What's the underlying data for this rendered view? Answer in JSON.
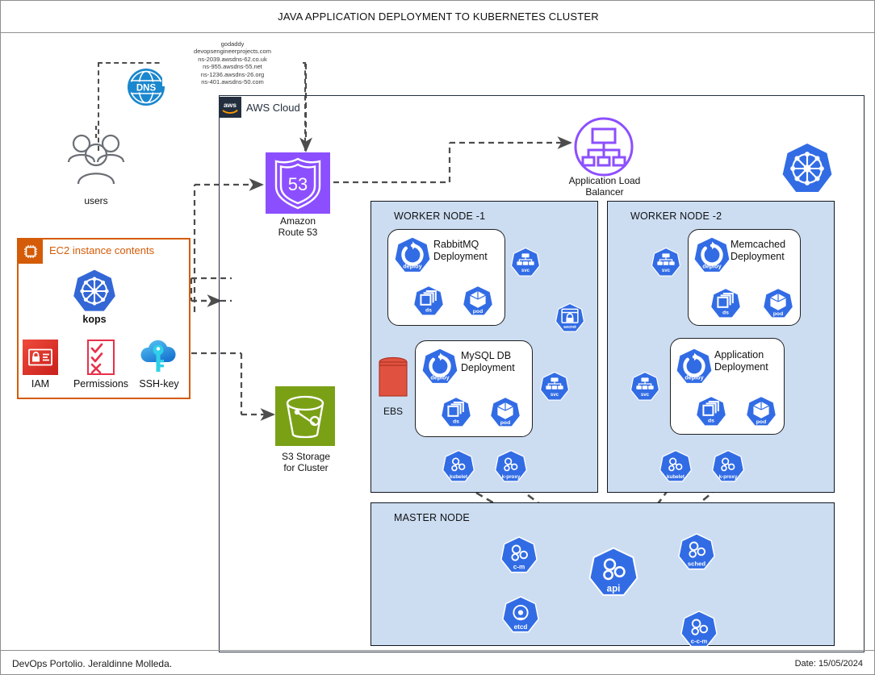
{
  "title": "JAVA APPLICATION DEPLOYMENT TO KUBERNETES CLUSTER",
  "footer": {
    "author": "DevOps Portolio. Jeraldinne Molleda.",
    "date": "Date: 15/05/2024"
  },
  "dns": {
    "icon_label": "DNS",
    "records": "godaddy\ndevopsengineerprojects.com\nns-2039.awsdns-62.co.uk\nns-955.awsdns-55.net\nns-1236.awsdns-26.org\nns-401.awsdns-50.com"
  },
  "users": {
    "label": "users"
  },
  "aws_cloud": {
    "label": "AWS Cloud",
    "tag": "aws"
  },
  "ec2": {
    "label": "EC2 instance contents",
    "items": [
      {
        "name": "kops",
        "icon": "kubernetes-kops-icon"
      },
      {
        "name": "IAM",
        "icon": "iam-icon"
      },
      {
        "name": "Permissions",
        "icon": "permissions-checklist-icon"
      },
      {
        "name": "SSH-key",
        "icon": "ssh-key-icon"
      }
    ]
  },
  "route53": {
    "label": "Amazon\nRoute 53",
    "line1": "Amazon",
    "line2": "Route 53",
    "glyph": "53",
    "color": "#8c4fff"
  },
  "s3": {
    "line1": "S3 Storage",
    "line2": "for Cluster",
    "color": "#7aa116"
  },
  "alb": {
    "line1": "Application Load",
    "line2": "Balancer",
    "color": "#8c4fff"
  },
  "k8s_logo": {
    "name": "kubernetes-logo",
    "color": "#326ce5"
  },
  "worker1": {
    "title": "WORKER NODE -1",
    "deployments": [
      {
        "title_line1": "RabbitMQ",
        "title_line2": "Deployment",
        "icons": [
          "deploy",
          "ds",
          "pod"
        ]
      },
      {
        "title_line1": "MySQL DB",
        "title_line2": "Deployment",
        "icons": [
          "deploy",
          "ds",
          "pod"
        ]
      }
    ],
    "resources": [
      {
        "label": "svc"
      },
      {
        "label": "secret"
      },
      {
        "label": "svc"
      },
      {
        "label": "kubelet"
      },
      {
        "label": "k-proxy"
      }
    ],
    "ebs": {
      "label": "EBS",
      "color": "#e0523f"
    }
  },
  "worker2": {
    "title": "WORKER NODE -2",
    "deployments": [
      {
        "title_line1": "Memcached",
        "title_line2": "Deployment",
        "icons": [
          "deploy",
          "ds",
          "pod"
        ]
      },
      {
        "title_line1": "Application",
        "title_line2": "Deployment",
        "icons": [
          "deploy",
          "ds",
          "pod"
        ]
      }
    ],
    "resources": [
      {
        "label": "svc"
      },
      {
        "label": "svc"
      },
      {
        "label": "kubelet"
      },
      {
        "label": "k-proxy"
      }
    ]
  },
  "master": {
    "title": "MASTER NODE",
    "components": [
      {
        "label": "c-m"
      },
      {
        "label": "etcd"
      },
      {
        "label": "api"
      },
      {
        "label": "sched"
      },
      {
        "label": "c-c-m"
      }
    ]
  },
  "colors": {
    "k8s_blue": "#326ce5",
    "node_panel": "#ccddf2",
    "aws_navy": "#232f3e",
    "ec2_orange": "#d45b07",
    "purple": "#8c4fff",
    "green": "#7aa116",
    "red": "#e0523f",
    "arrow": "#4d4d4d"
  }
}
